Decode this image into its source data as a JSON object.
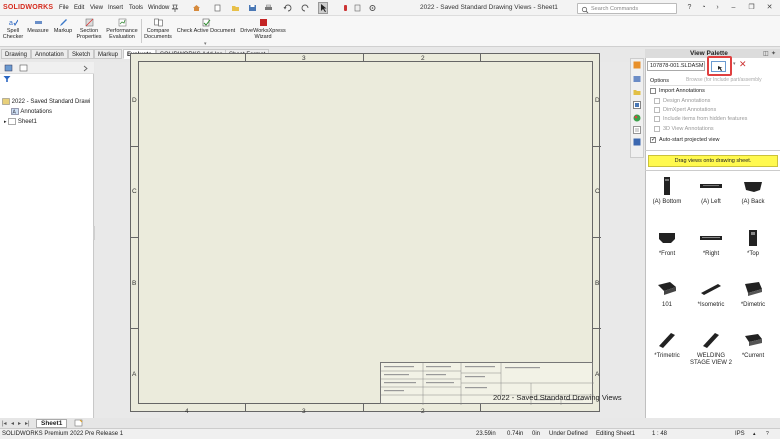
{
  "app": {
    "logo": "SOLIDWORKS",
    "title": "2022 - Saved Standard Drawing Views - Sheet1"
  },
  "menu": [
    "File",
    "Edit",
    "View",
    "Insert",
    "Tools",
    "Window"
  ],
  "search": {
    "placeholder": "Search Commands"
  },
  "ribbon": [
    {
      "label": "Spell\nChecker"
    },
    {
      "label": "Measure"
    },
    {
      "label": "Markup"
    },
    {
      "label": "Section\nProperties"
    },
    {
      "label": "Performance\nEvaluation"
    },
    {
      "label": "Compare\nDocuments"
    },
    {
      "label": "Check Active Document"
    },
    {
      "label": "DriveWorksXpress\nWizard"
    }
  ],
  "tabs": [
    "Drawing",
    "Annotation",
    "Sketch",
    "Markup",
    "Evaluate",
    "SOLIDWORKS Add-Ins",
    "Sheet Format"
  ],
  "active_tab": "Evaluate",
  "tree": {
    "root": "2022 - Saved Standard Drawi",
    "children": [
      "Annotations",
      "Sheet1"
    ]
  },
  "sheet": {
    "cols_top": [
      "3",
      "2"
    ],
    "cols_bottom": [
      "4",
      "3",
      "2"
    ],
    "rows_left": [
      "D",
      "C",
      "B",
      "A"
    ],
    "rows_right": [
      "D",
      "C",
      "B",
      "A"
    ],
    "title_name": "2022 - Saved Standard Drawing Views"
  },
  "palette": {
    "title": "View Palette",
    "file": "107878-001.SLDASM",
    "tooltip": "Browse (for Include part/assembly",
    "options_label": "Options",
    "options": [
      {
        "label": "Import Annotations",
        "checked": false,
        "dim": false
      },
      {
        "label": "Design Annotations",
        "checked": false,
        "dim": true
      },
      {
        "label": "DimXpert Annotations",
        "checked": false,
        "dim": true
      },
      {
        "label": "Include items from hidden features",
        "checked": false,
        "dim": true
      },
      {
        "label": "3D View Annotations",
        "checked": false,
        "dim": true
      },
      {
        "label": "Auto-start projected view",
        "checked": true,
        "dim": false
      }
    ],
    "hint": "Drag views onto drawing sheet.",
    "views": [
      "(A) Bottom",
      "(A) Left",
      "(A) Back",
      "*Front",
      "*Right",
      "*Top",
      "101",
      "*Isometric",
      "*Dimetric",
      "*Trimetric",
      "WELDING\nSTAGE VIEW 2",
      "*Current"
    ]
  },
  "sheet_tab": "Sheet1",
  "status": {
    "product": "SOLIDWORKS Premium 2022 Pre Release 1",
    "x": "23.59in",
    "y": "0.74in",
    "z": "0in",
    "state": "Under Defined",
    "mode": "Editing Sheet1",
    "scale": "1 : 48",
    "units": "IPS"
  },
  "colors": {
    "accent_red": "#d52b1e",
    "highlight": "#e04040",
    "hint_bg": "#fff94f"
  }
}
